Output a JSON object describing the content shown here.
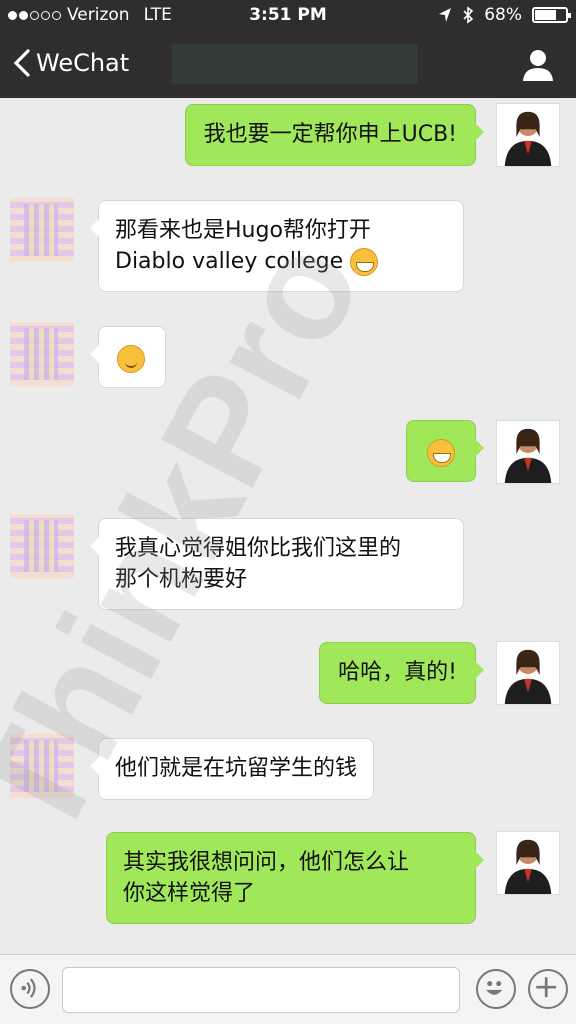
{
  "status": {
    "carrier": "Verizon",
    "network": "LTE",
    "time": "3:51 PM",
    "battery": "68%"
  },
  "nav": {
    "back_label": "WeChat"
  },
  "messages": [
    {
      "side": "out",
      "text": "我也要一定帮你申上UCB!"
    },
    {
      "side": "in",
      "line1": "那看来也是Hugo帮你打开",
      "line2": "Diablo valley college"
    },
    {
      "side": "in",
      "emoji": "smile"
    },
    {
      "side": "out",
      "emoji": "grin"
    },
    {
      "side": "in",
      "line1": "我真心觉得姐你比我们这里的",
      "line2": "那个机构要好"
    },
    {
      "side": "out",
      "text": "哈哈，真的!"
    },
    {
      "side": "in",
      "text": "他们就是在坑留学生的钱"
    },
    {
      "side": "out",
      "line1": "其实我很想问问，他们怎么让",
      "line2": "你这样觉得了"
    }
  ],
  "input": {
    "placeholder": ""
  },
  "watermark": {
    "text": "ThinkPro"
  },
  "colors": {
    "bar": "#2e2e2e",
    "bubble_out": "#a0e75a",
    "background": "#ebebeb"
  }
}
